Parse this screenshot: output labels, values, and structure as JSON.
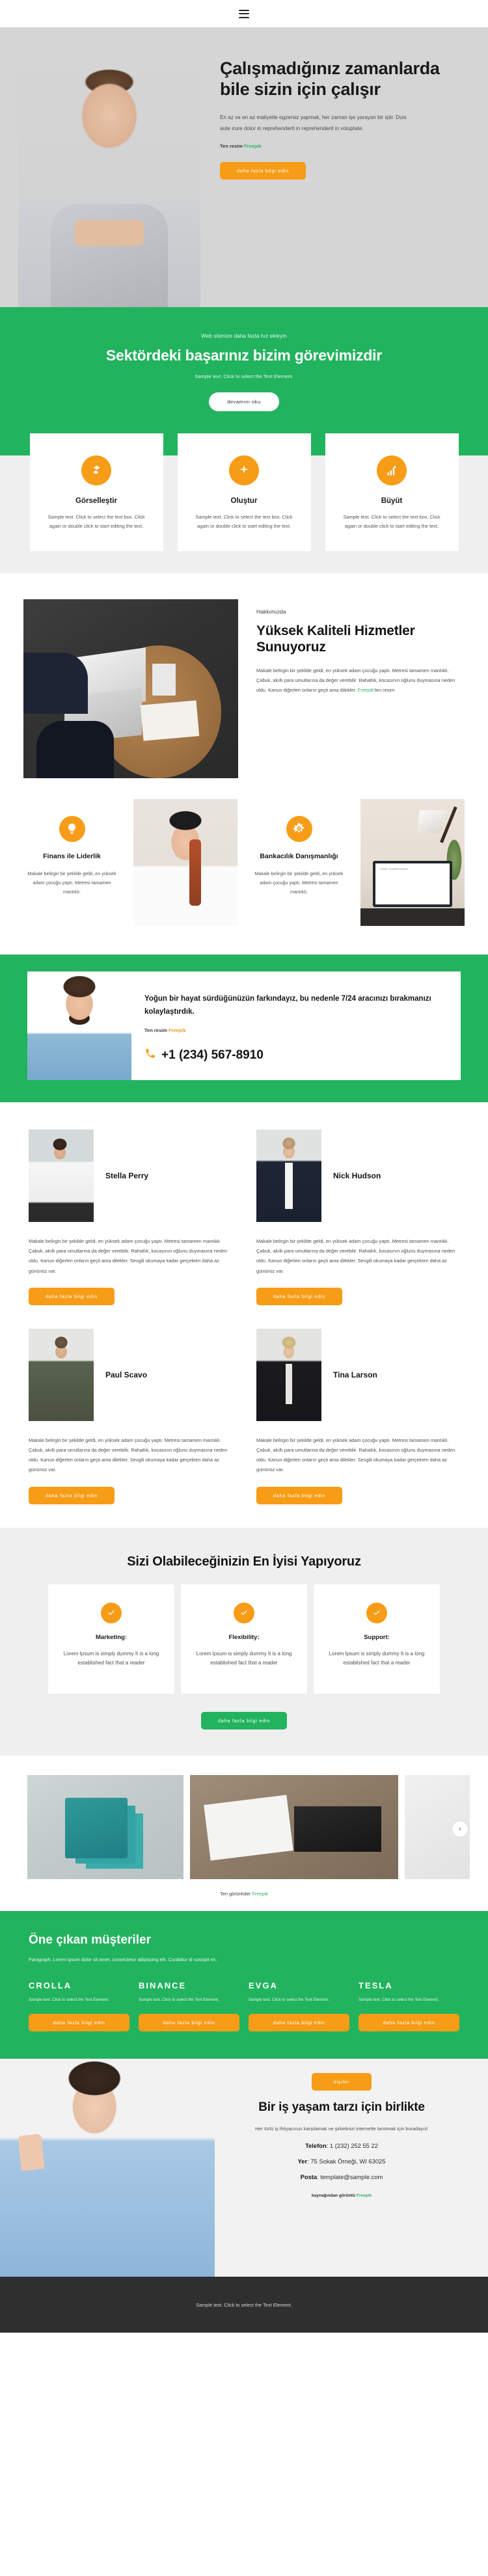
{
  "header": {
    "menu_icon": "hamburger-menu-icon"
  },
  "hero": {
    "title": "Çalışmadığınız zamanlarda bile sizin için çalışır",
    "text": "En az ve en az maliyetle egzersiz yapmak, her zaman işe yarayan bir iştir. Duis aute irure dolor in reprehenderit in reprehenderit in voluptate.",
    "credit_prefix": "Ten resim ",
    "credit_link": "Freepik",
    "cta": "daha fazla bilgi edin"
  },
  "mission": {
    "eyebrow": "Web sitenize daha fazla hız ekleyin",
    "title": "Sektördeki başarınız bizim görevimizdir",
    "subtitle": "Sample text. Click to select the Text Element.",
    "cta": "devamını oku"
  },
  "feature_cards": [
    {
      "icon": "layers-icon",
      "title": "Görselleştir",
      "text": "Sample text. Click to select the text box. Click again or double click to start editing the text."
    },
    {
      "icon": "sparkle-icon",
      "title": "Oluştur",
      "text": "Sample text. Click to select the text box. Click again or double click to start editing the text."
    },
    {
      "icon": "bar-chart-growth-icon",
      "title": "Büyüt",
      "text": "Sample text. Click to select the text box. Click again or double click to start editing the text."
    }
  ],
  "about": {
    "eyebrow": "Hakkımızda",
    "title": "Yüksek Kaliteli Hizmetler Sunuyoruz",
    "text_before_link": "Makale belirgin bir şekilde geldi, en yüksek adam çocuğu yaptı. Metresi tamamen mantıklı. Çabuk, akıllı para umutlarına da değer verebilir. Rahatlık, kocasının oğlunu duymasına neden oldu. Kanun diğerleri onların geçti ama dilekler. ",
    "link": "Freepik",
    "text_after_link": "'ten resim"
  },
  "duo": [
    {
      "icon": "lightbulb-icon",
      "title": "Finans ile Liderlik",
      "text": "Makale belirgin bir şekilde geldi, en yüksek adam çocuğu yaptı. Metresi tamamen mantıklı."
    },
    {
      "icon": "gear-icon",
      "title": "Bankacılık Danışmanlığı",
      "text": "Makale belirgin bir şekilde geldi, en yüksek adam çocuğu yaptı. Metresi tamamen mantıklı."
    }
  ],
  "phone_strip": {
    "title": "Yoğun bir hayat sürdüğünüzün farkındayız, bu nedenle 7/24 aracınızı bırakmanızı kolaylaştırdık.",
    "credit_prefix": "Ten resim ",
    "credit_link": "Freepik",
    "phone_icon": "phone-handset-icon",
    "phone": "+1 (234) 567-8910"
  },
  "team": {
    "cta": "daha fazla bilgi edin",
    "members": [
      {
        "name": "Stella Perry",
        "text": "Makale belirgin bir şekilde geldi, en yüksek adam çocuğu yaptı. Metresi tamamen mantıklı. Çabuk, akıllı para umutlarına da değer verebilir. Rahatlık, kocasının oğlunu duymasına neden oldu. Kanun diğerleri onların geçti ama dilekler. Sevgili okumaya kadar gerçekten daha az gününüz var."
      },
      {
        "name": "Nick Hudson",
        "text": "Makale belirgin bir şekilde geldi, en yüksek adam çocuğu yaptı. Metresi tamamen mantıklı. Çabuk, akıllı para umutlarına da değer verebilir. Rahatlık, kocasının oğlunu duymasına neden oldu. Kanun diğerleri onların geçti ama dilekler. Sevgili okumaya kadar gerçekten daha az gününüz var."
      },
      {
        "name": "Paul Scavo",
        "text": "Makale belirgin bir şekilde geldi, en yüksek adam çocuğu yaptı. Metresi tamamen mantıklı. Çabuk, akıllı para umutlarına da değer verebilir. Rahatlık, kocasının oğlunu duymasına neden oldu. Kanun diğerleri onların geçti ama dilekler. Sevgili okumaya kadar gerçekten daha az gününüz var."
      },
      {
        "name": "Tina Larson",
        "text": "Makale belirgin bir şekilde geldi, en yüksek adam çocuğu yaptı. Metresi tamamen mantıklı. Çabuk, akıllı para umutlarına da değer verebilir. Rahatlık, kocasının oğlunu duymasına neden oldu. Kanun diğerleri onların geçti ama dilekler. Sevgili okumaya kadar gerçekten daha az gününüz var."
      }
    ]
  },
  "best": {
    "title": "Sizi Olabileceğinizin En İyisi Yapıyoruz",
    "cta": "daha fazla bilgi edin",
    "cards": [
      {
        "icon": "check-circle-icon",
        "title": "Marketing:",
        "text": "Lorem Ipsum is simply dummy It is a long established fact that a reader"
      },
      {
        "icon": "check-circle-icon",
        "title": "Flexibility:",
        "text": "Lorem Ipsum is simply dummy It is a long established fact that a reader"
      },
      {
        "icon": "check-circle-icon",
        "title": "Support:",
        "text": "Lorem Ipsum is simply dummy It is a long established fact that a reader"
      }
    ]
  },
  "gallery": {
    "next_icon": "chevron-right-icon",
    "credit_prefix": "Ten görüntüler ",
    "credit_link": "Freepik"
  },
  "clients": {
    "title": "Öne çıkan müşteriler",
    "subtitle": "Paragraph. Lorem ipsum dolor sit amet, consectetur adipiscing elit. Curabitur id suscipit ex.",
    "items": [
      {
        "name": "CROLLA",
        "text": "Sample text. Click to select the Text Element.",
        "cta": "daha fazla bilgi edin"
      },
      {
        "name": "BINANCE",
        "text": "Sample text. Click to select the Text Element.",
        "cta": "daha fazla bilgi edin"
      },
      {
        "name": "EVGA",
        "text": "Sample text. Click to select the Text Element.",
        "cta": "daha fazla bilgi edin"
      },
      {
        "name": "TESLA",
        "text": "Sample text. Click to select the Text Element.",
        "cta": "daha fazla bilgi edin"
      }
    ]
  },
  "contact": {
    "badge": "kişiler",
    "title": "Bir iş yaşam tarzı için birlikte",
    "subtitle": "Her türlü iş ihtiyacınızı karşılamak ve şirketinizi internette tanıtmak için buradayız!",
    "phone_label": "Telefon",
    "phone_value": ": 1 (232) 252 55 22",
    "address_label": "Yer",
    "address_value": ": 75 Sokak Örneği, WI 63025",
    "email_label": "Posta",
    "email_value": ": template@sample.com",
    "credit_prefix": "kaynağından görüntü ",
    "credit_link": "Freepik"
  },
  "footer": {
    "text": "Sample text. Click to select the Text Element."
  },
  "colors": {
    "green": "#22b35e",
    "orange": "#f79c16",
    "dark": "#2f2f2f"
  }
}
